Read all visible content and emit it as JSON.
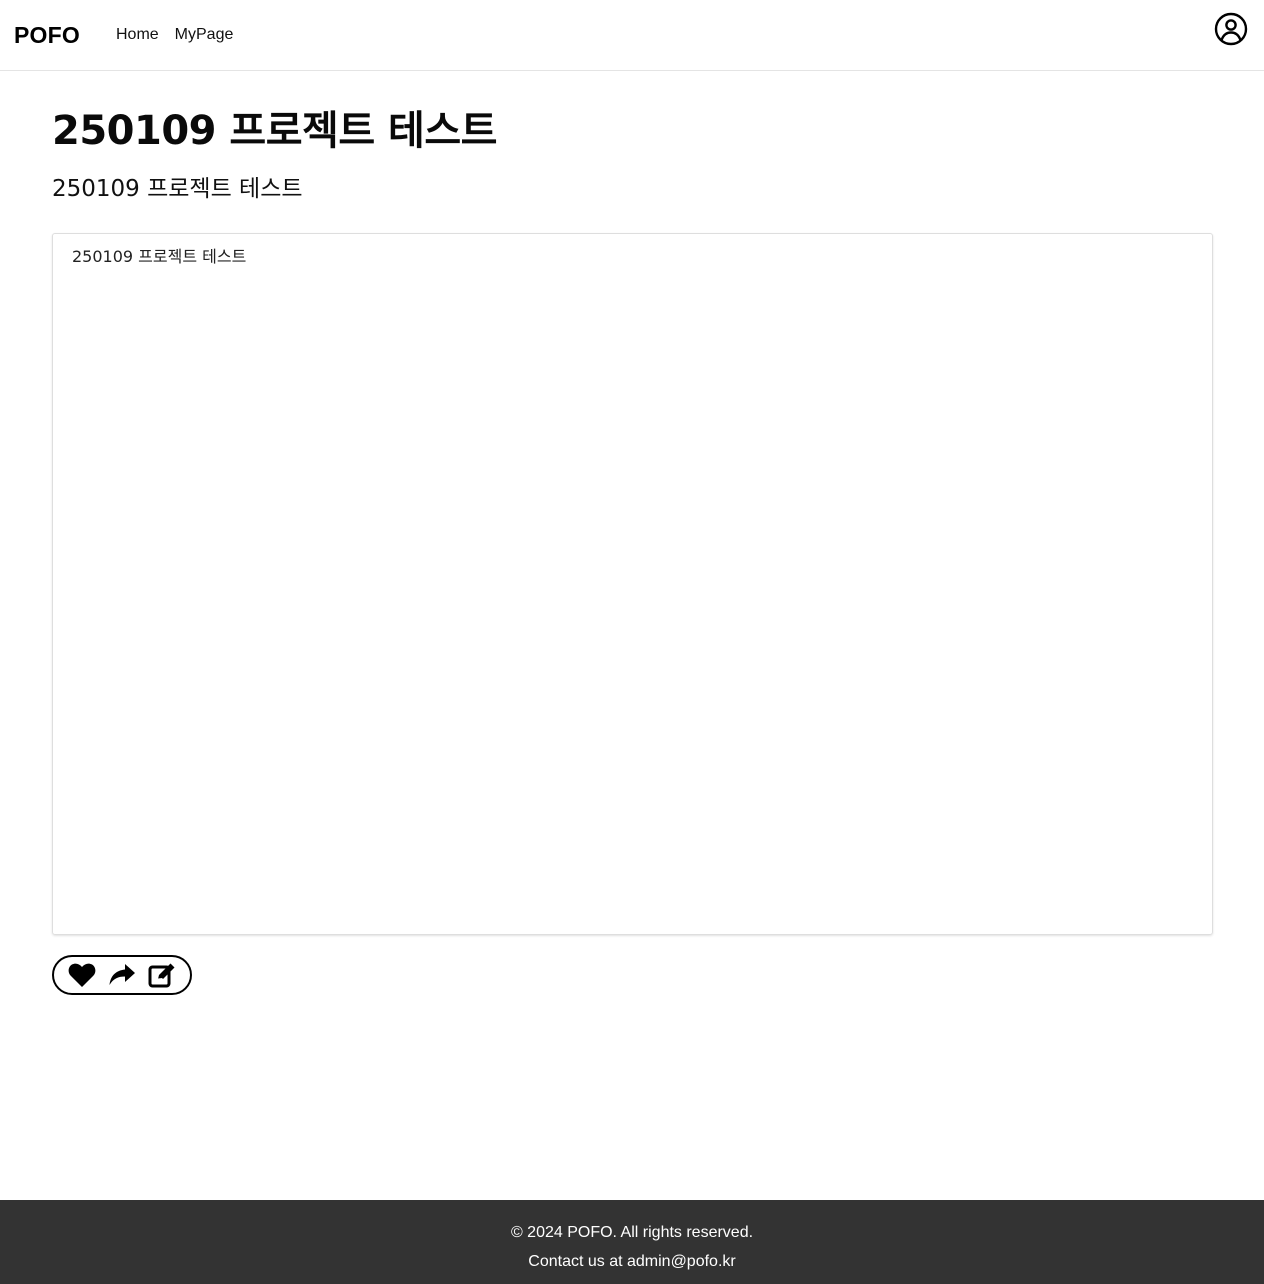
{
  "header": {
    "brand": "POFO",
    "nav": [
      {
        "label": "Home"
      },
      {
        "label": "MyPage"
      }
    ],
    "profile_icon": "user-circle-icon"
  },
  "post": {
    "title": "250109 프로젝트 테스트",
    "subtitle": "250109 프로젝트 테스트",
    "content": "250109 프로젝트 테스트"
  },
  "actions": {
    "icons": [
      "heart-icon",
      "share-icon",
      "edit-icon"
    ]
  },
  "footer": {
    "copyright": "© 2024 POFO. All rights reserved.",
    "contact": "Contact us at admin@pofo.kr"
  },
  "colors": {
    "footer_bg": "#333333",
    "text": "#111111",
    "border": "#dedede"
  }
}
